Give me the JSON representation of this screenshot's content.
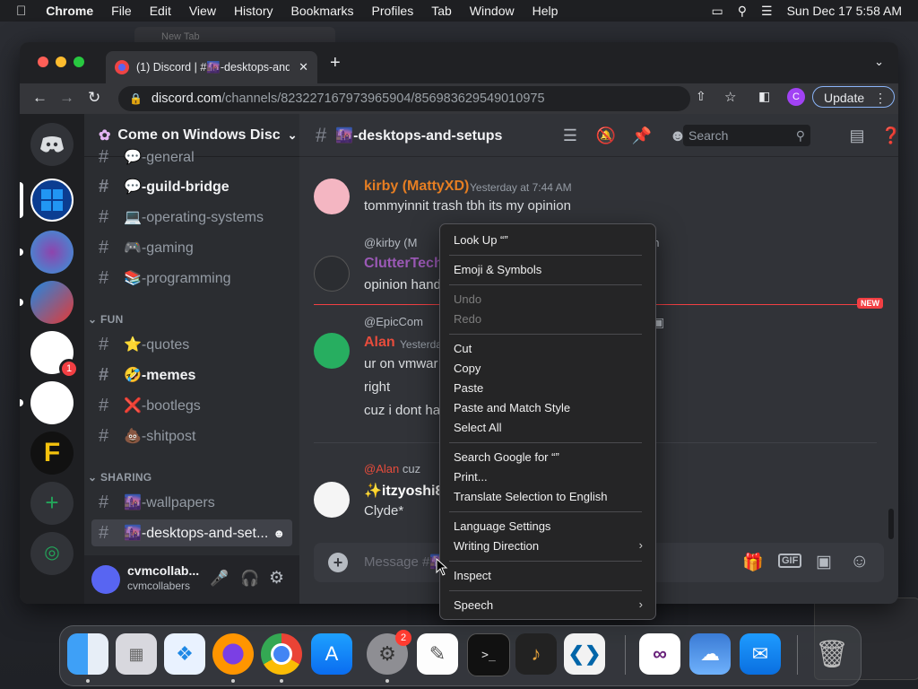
{
  "menubar": {
    "app": "Chrome",
    "items": [
      "File",
      "Edit",
      "View",
      "History",
      "Bookmarks",
      "Profiles",
      "Tab",
      "Window",
      "Help"
    ],
    "clock": "Sun Dec 17  5:58 AM"
  },
  "browser": {
    "tab_title": "(1) Discord | #🌆-desktops-and-",
    "bg_tab_title": "New Tab",
    "url_host": "discord.com",
    "url_path": "/channels/823227167973965904/856983629549010975",
    "profile_initial": "C",
    "update_label": "Update"
  },
  "server": {
    "name": "Come on Windows Disc",
    "categories": {
      "fun": "FUN",
      "sharing": "SHARING"
    },
    "channels": [
      {
        "name": "💬-general",
        "state": "normal"
      },
      {
        "name": "💬-guild-bridge",
        "state": "unread"
      },
      {
        "name": "💻-operating-systems",
        "state": "normal"
      },
      {
        "name": "🎮-gaming",
        "state": "normal"
      },
      {
        "name": "📚-programming",
        "state": "normal"
      },
      {
        "name": "⭐-quotes",
        "state": "normal"
      },
      {
        "name": "🤣-memes",
        "state": "unread"
      },
      {
        "name": "❌-bootlegs",
        "state": "normal"
      },
      {
        "name": "💩-shitpost",
        "state": "normal"
      },
      {
        "name": "🌆-wallpapers",
        "state": "normal"
      },
      {
        "name": "🌆-desktops-and-set...",
        "state": "active"
      }
    ]
  },
  "user": {
    "display": "cvmcollab...",
    "username": "cvmcollabers"
  },
  "chat": {
    "channel": "🌆-desktops-and-setups",
    "search_placeholder": "Search",
    "composer_placeholder": "Message #🌆",
    "new_badge": "NEW",
    "messages": [
      {
        "author": "kirby (MattyXD)",
        "time": "Yesterday at 7:44 AM",
        "text": "tommyinnit trash tbh its my opinion",
        "color": "#e67e22"
      },
      {
        "reply_to": "@kirby (M",
        "reply_tail": "inion",
        "author": "ClutterTech",
        "text": "opinion hand",
        "color": "#9b59b6"
      },
      {
        "reply_to": "@EpicCom",
        "author": "Alan",
        "time": "Yesterda",
        "lines": [
          "ur on vmwar",
          "right",
          "cuz i dont ha"
        ],
        "color": "#e74c3c"
      },
      {
        "reply_to": "@Alan",
        "reply_tail": "cuz",
        "author": "✨itzyoshi87",
        "text": "Clyde*",
        "color": "#ffffff"
      }
    ]
  },
  "guild_badge": "1",
  "dock_badge": "2",
  "context_menu": {
    "items": [
      {
        "label": "Look Up “”",
        "enabled": true
      },
      {
        "label": "Emoji & Symbols",
        "enabled": true
      },
      {
        "label": "Undo",
        "enabled": false
      },
      {
        "label": "Redo",
        "enabled": false
      },
      {
        "label": "Cut",
        "enabled": true
      },
      {
        "label": "Copy",
        "enabled": true
      },
      {
        "label": "Paste",
        "enabled": true
      },
      {
        "label": "Paste and Match Style",
        "enabled": true
      },
      {
        "label": "Select All",
        "enabled": true
      },
      {
        "label": "Search Google for “”",
        "enabled": true
      },
      {
        "label": "Print...",
        "enabled": true
      },
      {
        "label": "Translate Selection to English",
        "enabled": true
      },
      {
        "label": "Language Settings",
        "enabled": true
      },
      {
        "label": "Writing Direction",
        "enabled": true,
        "submenu": true
      },
      {
        "label": "Inspect",
        "enabled": true
      },
      {
        "label": "Speech",
        "enabled": true,
        "submenu": true
      }
    ]
  },
  "colors": {
    "blurple": "#5865f2",
    "discord_bg": "#313338",
    "sidebar": "#2b2d31",
    "new_red": "#f23f43"
  }
}
